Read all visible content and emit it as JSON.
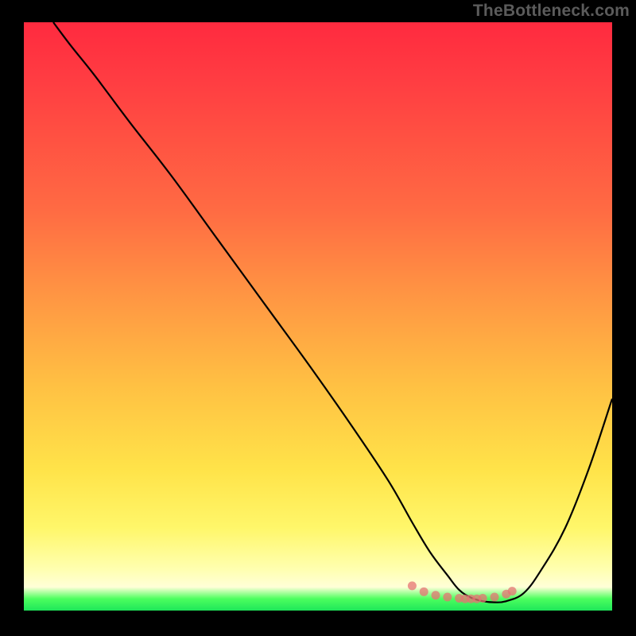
{
  "watermark": "TheBottleneck.com",
  "chart_data": {
    "type": "line",
    "title": "",
    "xlabel": "",
    "ylabel": "",
    "x_range": [
      0,
      100
    ],
    "y_range": [
      0,
      100
    ],
    "series": [
      {
        "name": "curve",
        "color": "#000000",
        "x": [
          5,
          8,
          12,
          18,
          25,
          33,
          41,
          49,
          56,
          62,
          66,
          69,
          72,
          74,
          76,
          78,
          80,
          82,
          85,
          88,
          92,
          96,
          100
        ],
        "y": [
          100,
          96,
          91,
          83,
          74,
          63,
          52,
          41,
          31,
          22,
          15,
          10,
          6,
          3.5,
          2.2,
          1.6,
          1.4,
          1.6,
          3,
          7,
          14,
          24,
          36
        ]
      },
      {
        "name": "markers",
        "color": "#e57373",
        "markers_only": true,
        "x": [
          66,
          68,
          70,
          72,
          74,
          75,
          76,
          77,
          78,
          80,
          82,
          83
        ],
        "y": [
          4.2,
          3.2,
          2.6,
          2.3,
          2.1,
          2.0,
          2.0,
          2.0,
          2.1,
          2.3,
          2.8,
          3.3
        ]
      }
    ],
    "gradient_stops": [
      {
        "offset": 0,
        "color": "#ff2a3f"
      },
      {
        "offset": 10,
        "color": "#ff3d42"
      },
      {
        "offset": 32,
        "color": "#ff6b43"
      },
      {
        "offset": 48,
        "color": "#ff9a43"
      },
      {
        "offset": 62,
        "color": "#ffc143"
      },
      {
        "offset": 76,
        "color": "#ffe349"
      },
      {
        "offset": 86,
        "color": "#fff76a"
      },
      {
        "offset": 93,
        "color": "#ffffb0"
      },
      {
        "offset": 96,
        "color": "#ffffd8"
      },
      {
        "offset": 98,
        "color": "#4cff5e"
      },
      {
        "offset": 100,
        "color": "#1ee65a"
      }
    ]
  }
}
